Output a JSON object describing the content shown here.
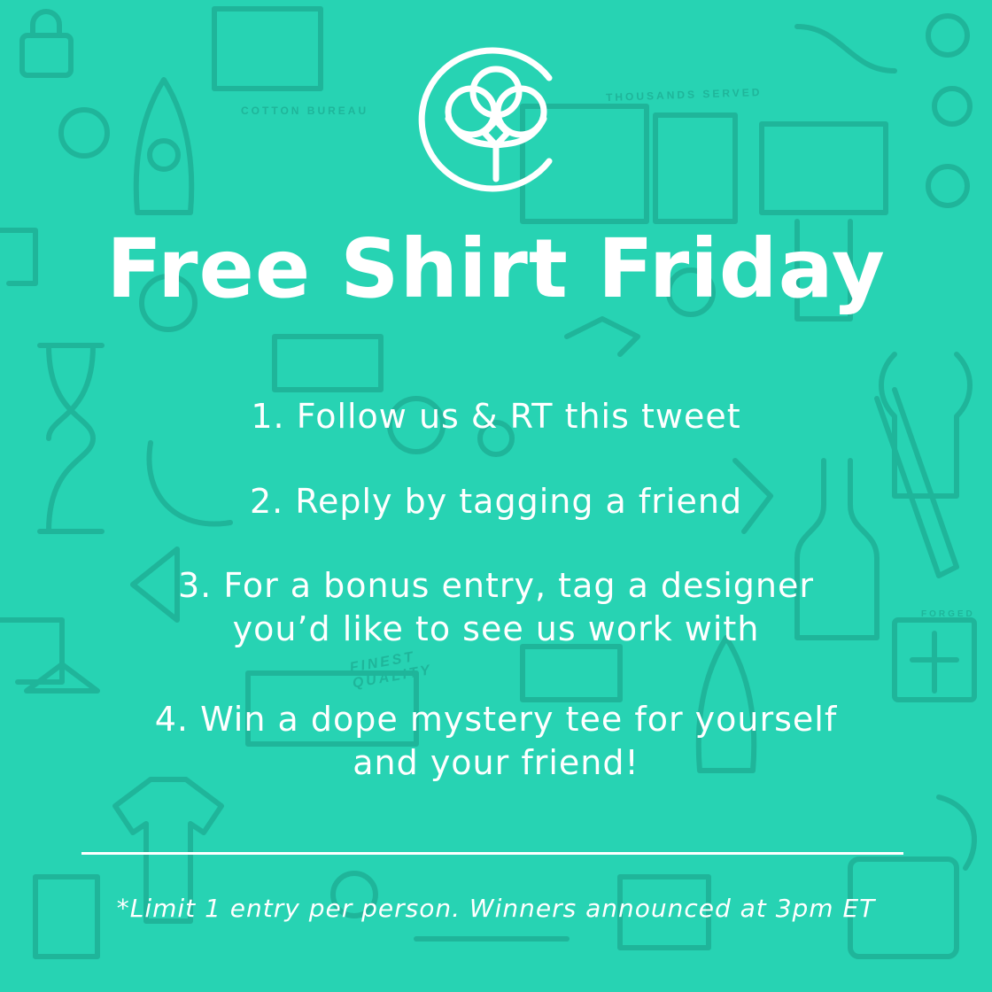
{
  "colors": {
    "background": "#27d3b3",
    "pattern": "#1fb59a",
    "text": "#ffffff"
  },
  "background_words": {
    "brand": "COTTON BUREAU",
    "served": "THOUSANDS SERVED",
    "quality": "FINEST QUALITY",
    "forged": "FORGED"
  },
  "logo": {
    "icon": "cotton-bureau-logo-icon"
  },
  "headline": "Free Shirt Friday",
  "rules": [
    {
      "text": "1. Follow us & RT this tweet"
    },
    {
      "text": "2. Reply by tagging a friend"
    },
    {
      "text": "3. For a bonus entry, tag a designer\nyou’d like to see us work with"
    },
    {
      "text": "4. Win a dope mystery tee for yourself\nand your friend!"
    }
  ],
  "footnote": "*Limit 1 entry per person. Winners announced at 3pm ET"
}
